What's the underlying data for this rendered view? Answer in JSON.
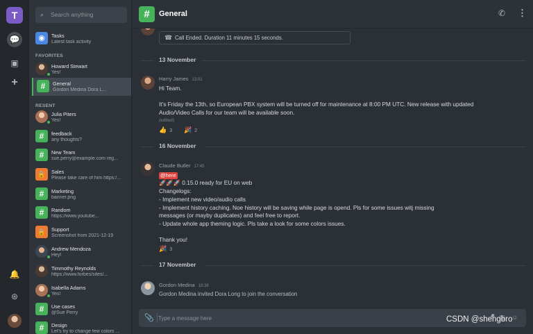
{
  "app": {
    "logo_letter": "T"
  },
  "sidebar": {
    "search_placeholder": "Search anything",
    "tasks": {
      "name": "Tasks",
      "sub": "Latest task activity"
    },
    "favorites_label": "FAVORITES",
    "favorites": [
      {
        "name": "Howard Stewart",
        "sub": "Yes!"
      },
      {
        "name": "General",
        "sub": "Gordon Medina Dora L..."
      }
    ],
    "recent_label": "RESENT",
    "recent": [
      {
        "name": "Julia Piters",
        "sub": "Yes!"
      },
      {
        "name": "feedback",
        "sub": "any thoughts?"
      },
      {
        "name": "New Team",
        "sub": "sue.perry@example.com reg..."
      },
      {
        "name": "Sales",
        "sub": "Please take care of him https:/..."
      },
      {
        "name": "Marketing",
        "sub": "banner.png"
      },
      {
        "name": "Random",
        "sub": "https://www.youtube..."
      },
      {
        "name": "Support",
        "sub": "Screenshot from 2021-12-19"
      },
      {
        "name": "Andrew Mendoza",
        "sub": "Hey!"
      },
      {
        "name": "Timmothy Reynolds",
        "sub": "https://www.forbes/sites/..."
      },
      {
        "name": "Isabella Adams",
        "sub": "Yes!"
      },
      {
        "name": "Use cases",
        "sub": "@Sue Perry"
      },
      {
        "name": "Design",
        "sub": "Let's try to change few colors ..."
      }
    ]
  },
  "header": {
    "title": "General"
  },
  "messages": {
    "call_ended": "Call Ended. Duration 11 minutes 15 seconds.",
    "date1": "13 November",
    "m1": {
      "author": "Harry James",
      "time": "13:01",
      "l1": "Hi Team.",
      "l2": "It's Friday the 13th, so European PBX system will be turned off for maintenance at 8:00 PM UTC. New release with updated",
      "l3": "Audio/Video Calls for our team will be available soon.",
      "edited": "(edited)",
      "r1_emoji": "👍",
      "r1_count": "3",
      "r2_emoji": "🎉",
      "r2_count": "2"
    },
    "date2": "16  November",
    "m2": {
      "author": "Claude Butler",
      "time": "17:45",
      "mention": "@here",
      "l1": "🚀🚀🚀 0.15.0 ready for EU on web",
      "l2": "Changelogs:",
      "l3": "- Implement new video/audio calls",
      "l4": "- Implement history caching. Noe history will be saving while page is opend. Pls for some issues witj missing",
      "l5": "messages (or mayby duplicates) and  feel free to report.",
      "l6": "- Update whole app theming logic. Pls take a look for some colors issues.",
      "l7": "Thank you!",
      "r1_emoji": "🎉",
      "r1_count": "3"
    },
    "date3": "17  November",
    "m3": {
      "author": "Gordon Medina",
      "time": "18:38",
      "l1": "Gordon Medina invited Dora Long to join the conversation"
    }
  },
  "composer": {
    "placeholder": "Type a message here"
  },
  "watermark": "CSDN @shengbro"
}
